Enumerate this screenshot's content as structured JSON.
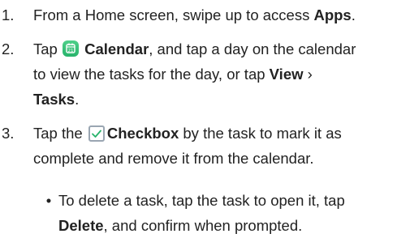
{
  "steps": [
    {
      "number": "1.",
      "pre": "From a Home screen, swipe up to access ",
      "bold": "Apps",
      "post": "."
    },
    {
      "number": "2.",
      "tap": "Tap ",
      "icon": "calendar-app-icon",
      "bold_calendar": "Calendar",
      "text1": ", and tap a day on the calendar",
      "text2": "to view the tasks for the day, or tap ",
      "bold_view": "View",
      "chevron": " ›",
      "bold_tasks": "Tasks",
      "end": "."
    },
    {
      "number": "3.",
      "tap_the": "Tap the ",
      "icon": "checkbox-icon",
      "bold_checkbox": "Checkbox",
      "text1": " by the task to mark it as",
      "text2": "complete and remove it from the calendar."
    }
  ],
  "substep": {
    "bullet": "•",
    "line1": "To delete a task, tap the task to open it, tap",
    "bold_delete": "Delete",
    "line2_rest": ", and confirm when prompted."
  },
  "colors": {
    "text": "#222222",
    "calendar_icon": "#27b36b",
    "checkbox_border": "#9aa6b2",
    "checkbox_check": "#27b36b"
  }
}
